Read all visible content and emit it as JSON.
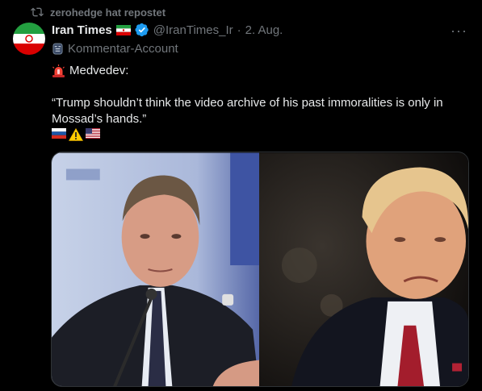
{
  "repost": {
    "text": "zerohedge hat repostet",
    "icon": "repost-icon"
  },
  "author": {
    "name": "Iran Times",
    "handle": "@IranTimes_Ir",
    "separator": "·",
    "date": "2. Aug.",
    "affiliation": "Kommentar-Account",
    "verified_color": "#1d9bf0"
  },
  "more_label": "···",
  "tweet": {
    "headline": "Medvedev:",
    "quote": "“Trump shouldn’t think the video archive of his past immoralities is only in Mossad’s hands.”",
    "flags": [
      "russia-flag-emoji",
      "warning-emoji",
      "us-flag-emoji"
    ]
  },
  "media": {
    "left_image": "medvedev-photo",
    "right_image": "trump-photo"
  },
  "colors": {
    "background": "#000000",
    "text": "#e7e9ea",
    "muted": "#71767b",
    "accent": "#1d9bf0"
  }
}
